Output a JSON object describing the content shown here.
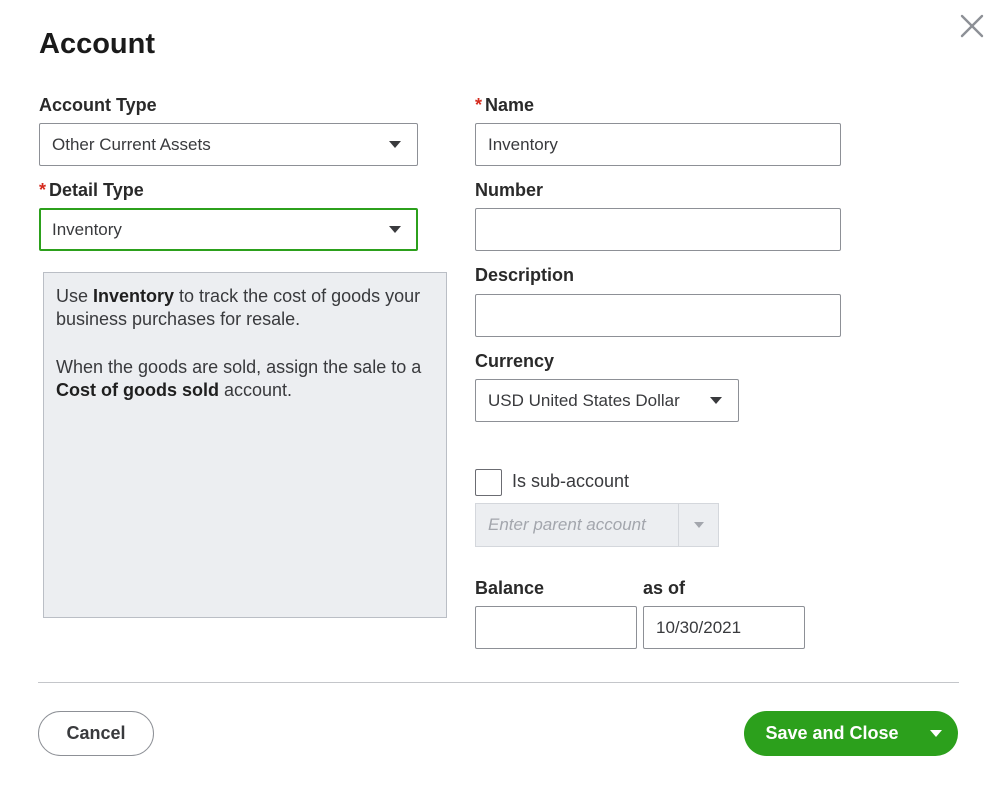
{
  "dialog": {
    "title": "Account"
  },
  "account_type": {
    "label": "Account Type",
    "value": "Other Current Assets"
  },
  "detail_type": {
    "required_marker": "*",
    "label": "Detail Type",
    "value": "Inventory"
  },
  "info": {
    "p1_pre": "Use ",
    "p1_bold": "Inventory",
    "p1_post": " to track the cost of goods your business purchases for resale.",
    "p2_pre": "When the goods are sold, assign the sale to a ",
    "p2_bold": "Cost of goods sold",
    "p2_post": " account."
  },
  "name": {
    "required_marker": "*",
    "label": "Name",
    "value": "Inventory"
  },
  "number": {
    "label": "Number",
    "value": ""
  },
  "description": {
    "label": "Description",
    "value": ""
  },
  "currency": {
    "label": "Currency",
    "value": "USD United States Dollar"
  },
  "sub_account": {
    "label": "Is sub-account",
    "checked": false,
    "parent_placeholder": "Enter parent account"
  },
  "balance": {
    "label": "Balance",
    "value": "",
    "as_of_label": "as of",
    "as_of_value": "10/30/2021"
  },
  "footer": {
    "cancel_label": "Cancel",
    "save_label": "Save and Close"
  },
  "colors": {
    "accent_green": "#2ca01c",
    "required_red": "#d52b1e"
  },
  "icons": {
    "close": "close-icon",
    "dropdown": "chevron-down-icon"
  }
}
